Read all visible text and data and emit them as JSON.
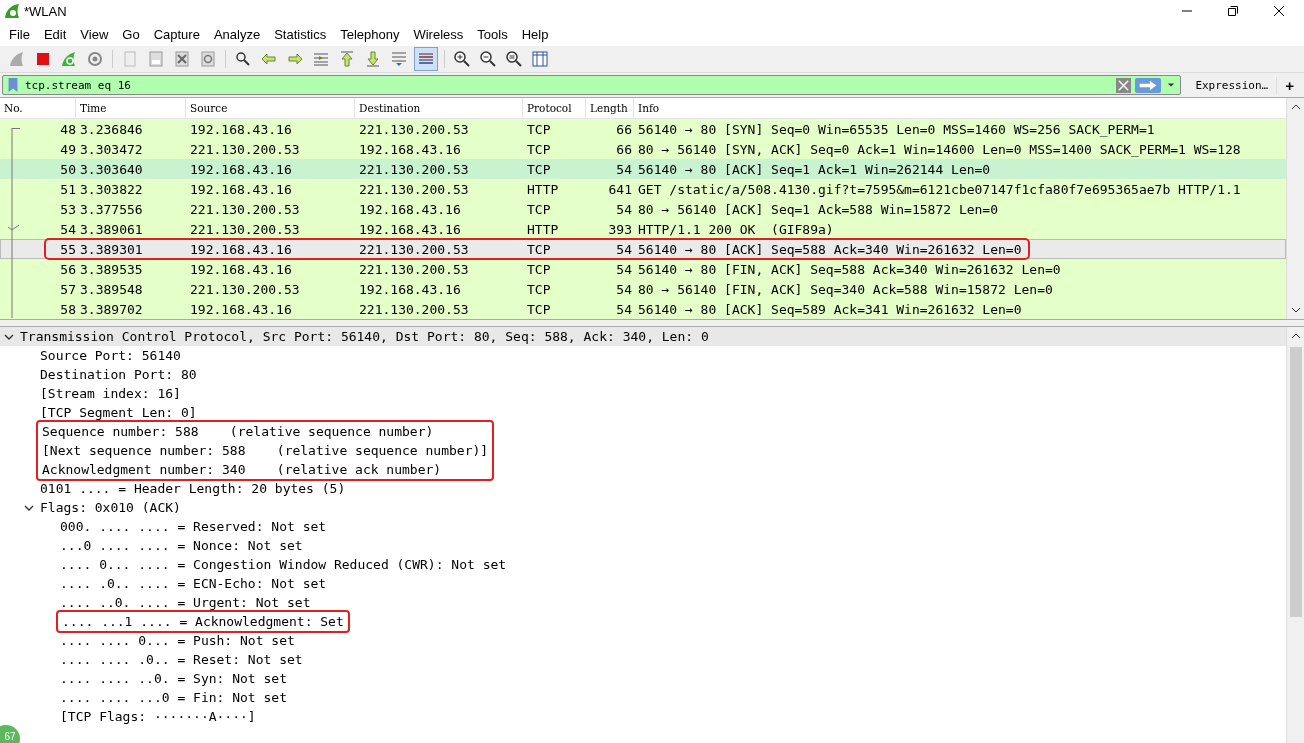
{
  "window": {
    "title": "*WLAN"
  },
  "menu": [
    "File",
    "Edit",
    "View",
    "Go",
    "Capture",
    "Analyze",
    "Statistics",
    "Telephony",
    "Wireless",
    "Tools",
    "Help"
  ],
  "toolbar": {
    "colorize_pressed": true
  },
  "filter": {
    "value": "tcp.stream eq 16",
    "valid": true,
    "expression_button": "Expression…",
    "add_button": "+"
  },
  "packet_list": {
    "columns": [
      "No.",
      "Time",
      "Source",
      "Destination",
      "Protocol",
      "Length",
      "Info"
    ],
    "rows": [
      {
        "no": "48",
        "time": "3.236846",
        "source": "192.168.43.16",
        "destination": "221.130.200.53",
        "protocol": "TCP",
        "length": "66",
        "info": "56140 → 80 [SYN] Seq=0 Win=65535 Len=0 MSS=1460 WS=256 SACK_PERM=1",
        "selected": false,
        "hovered": false,
        "annotated": false
      },
      {
        "no": "49",
        "time": "3.303472",
        "source": "221.130.200.53",
        "destination": "192.168.43.16",
        "protocol": "TCP",
        "length": "66",
        "info": "80 → 56140 [SYN, ACK] Seq=0 Ack=1 Win=14600 Len=0 MSS=1400 SACK_PERM=1 WS=128",
        "selected": false,
        "hovered": false,
        "annotated": false
      },
      {
        "no": "50",
        "time": "3.303640",
        "source": "192.168.43.16",
        "destination": "221.130.200.53",
        "protocol": "TCP",
        "length": "54",
        "info": "56140 → 80 [ACK] Seq=1 Ack=1 Win=262144 Len=0",
        "selected": false,
        "hovered": true,
        "annotated": false
      },
      {
        "no": "51",
        "time": "3.303822",
        "source": "192.168.43.16",
        "destination": "221.130.200.53",
        "protocol": "HTTP",
        "length": "641",
        "info": "GET /static/a/508.4130.gif?t=7595&m=6121cbe07147f1cfa80f7e695365ae7b HTTP/1.1",
        "selected": false,
        "hovered": false,
        "annotated": false
      },
      {
        "no": "53",
        "time": "3.377556",
        "source": "221.130.200.53",
        "destination": "192.168.43.16",
        "protocol": "TCP",
        "length": "54",
        "info": "80 → 56140 [ACK] Seq=1 Ack=588 Win=15872 Len=0",
        "selected": false,
        "hovered": false,
        "annotated": false
      },
      {
        "no": "54",
        "time": "3.389061",
        "source": "221.130.200.53",
        "destination": "192.168.43.16",
        "protocol": "HTTP",
        "length": "393",
        "info": "HTTP/1.1 200 OK  (GIF89a)",
        "selected": false,
        "hovered": false,
        "annotated": false
      },
      {
        "no": "55",
        "time": "3.389301",
        "source": "192.168.43.16",
        "destination": "221.130.200.53",
        "protocol": "TCP",
        "length": "54",
        "info": "56140 → 80 [ACK] Seq=588 Ack=340 Win=261632 Len=0",
        "selected": true,
        "hovered": false,
        "annotated": true
      },
      {
        "no": "56",
        "time": "3.389535",
        "source": "192.168.43.16",
        "destination": "221.130.200.53",
        "protocol": "TCP",
        "length": "54",
        "info": "56140 → 80 [FIN, ACK] Seq=588 Ack=340 Win=261632 Len=0",
        "selected": false,
        "hovered": false,
        "annotated": false
      },
      {
        "no": "57",
        "time": "3.389548",
        "source": "221.130.200.53",
        "destination": "192.168.43.16",
        "protocol": "TCP",
        "length": "54",
        "info": "80 → 56140 [FIN, ACK] Seq=340 Ack=588 Win=15872 Len=0",
        "selected": false,
        "hovered": false,
        "annotated": false
      },
      {
        "no": "58",
        "time": "3.389702",
        "source": "192.168.43.16",
        "destination": "221.130.200.53",
        "protocol": "TCP",
        "length": "54",
        "info": "56140 → 80 [ACK] Seq=589 Ack=341 Win=261632 Len=0",
        "selected": false,
        "hovered": false,
        "annotated": false
      }
    ]
  },
  "detail": [
    {
      "text": "Transmission Control Protocol, Src Port: 56140, Dst Port: 80, Seq: 588, Ack: 340, Len: 0",
      "expanded": true,
      "selected": true,
      "annotated": false,
      "children": [
        {
          "text": "Source Port: 56140",
          "selected": false,
          "annotated": false
        },
        {
          "text": "Destination Port: 80",
          "selected": false,
          "annotated": false
        },
        {
          "text": "[Stream index: 16]",
          "selected": false,
          "annotated": false
        },
        {
          "text": "[TCP Segment Len: 0]",
          "selected": false,
          "annotated": false
        },
        {
          "text": "Sequence number: 588    (relative sequence number)",
          "selected": false,
          "annotated": true
        },
        {
          "text": "[Next sequence number: 588    (relative sequence number)]",
          "selected": false,
          "annotated": true
        },
        {
          "text": "Acknowledgment number: 340    (relative ack number)",
          "selected": false,
          "annotated": true
        },
        {
          "text": "0101 .... = Header Length: 20 bytes (5)",
          "selected": false,
          "annotated": false
        },
        {
          "text": "Flags: 0x010 (ACK)",
          "expanded": true,
          "selected": false,
          "annotated": false,
          "children": [
            {
              "text": "000. .... .... = Reserved: Not set",
              "selected": false,
              "annotated": false
            },
            {
              "text": "...0 .... .... = Nonce: Not set",
              "selected": false,
              "annotated": false
            },
            {
              "text": ".... 0... .... = Congestion Window Reduced (CWR): Not set",
              "selected": false,
              "annotated": false
            },
            {
              "text": ".... .0.. .... = ECN-Echo: Not set",
              "selected": false,
              "annotated": false
            },
            {
              "text": ".... ..0. .... = Urgent: Not set",
              "selected": false,
              "annotated": false
            },
            {
              "text": ".... ...1 .... = Acknowledgment: Set",
              "selected": false,
              "annotated": true
            },
            {
              "text": ".... .... 0... = Push: Not set",
              "selected": false,
              "annotated": false
            },
            {
              "text": ".... .... .0.. = Reset: Not set",
              "selected": false,
              "annotated": false
            },
            {
              "text": ".... .... ..0. = Syn: Not set",
              "selected": false,
              "annotated": false
            },
            {
              "text": ".... .... ...0 = Fin: Not set",
              "selected": false,
              "annotated": false
            },
            {
              "text": "[TCP Flags: ·······A····]",
              "selected": false,
              "annotated": false
            }
          ]
        }
      ]
    }
  ],
  "corner_badge": "67"
}
